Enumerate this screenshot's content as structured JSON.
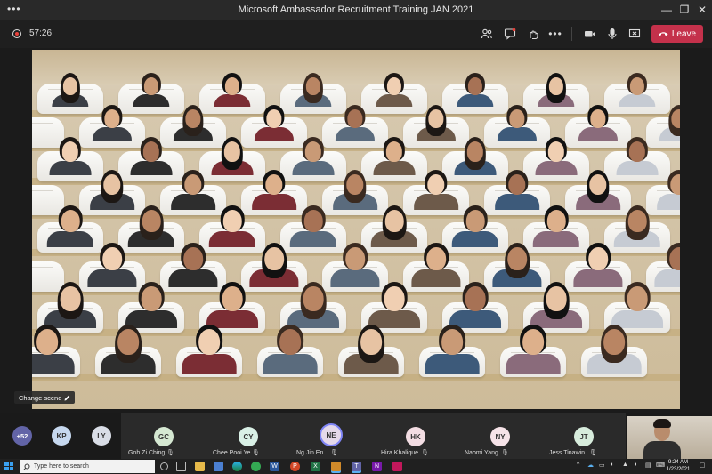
{
  "window": {
    "title": "Microsoft Ambassador Recruitment Training JAN 2021",
    "more_glyph": "•••",
    "minimize_glyph": "—",
    "maximize_glyph": "❐",
    "close_glyph": "✕"
  },
  "toolbar": {
    "timer": "57:26",
    "leave_label": "Leave",
    "icons": [
      "participants-icon",
      "chat-icon",
      "reactions-icon",
      "more-options-icon",
      "camera-icon",
      "microphone-icon",
      "share-screen-icon",
      "phone-icon"
    ]
  },
  "stage": {
    "change_scene_label": "Change scene"
  },
  "participants_strip": {
    "overflow_badge": "+52",
    "tiles": [
      {
        "initials": "KP",
        "name": "",
        "color": "#c6d8ef",
        "muted": false
      },
      {
        "initials": "LY",
        "name": "",
        "color": "#d9dde6",
        "muted": false
      },
      {
        "initials": "GC",
        "name": "Goh Zi Ching",
        "color": "#d5e8d2",
        "muted": true
      },
      {
        "initials": "CY",
        "name": "Chee Pooi Ye",
        "color": "#d9f0e6",
        "muted": true
      },
      {
        "initials": "NE",
        "name": "Ng Jin En",
        "color": "#e5d9ea",
        "muted": true,
        "speaking": true
      },
      {
        "initials": "HK",
        "name": "Hira Khalique",
        "color": "#f3dde3",
        "muted": true
      },
      {
        "initials": "NY",
        "name": "Naomi Yang",
        "color": "#f6e3e8",
        "muted": true
      },
      {
        "initials": "JT",
        "name": "Jess Tinawin",
        "color": "#d7ecdc",
        "muted": true
      }
    ]
  },
  "taskbar": {
    "search_placeholder": "Type here to search",
    "time": "9:24 AM",
    "date": "1/23/2021"
  }
}
